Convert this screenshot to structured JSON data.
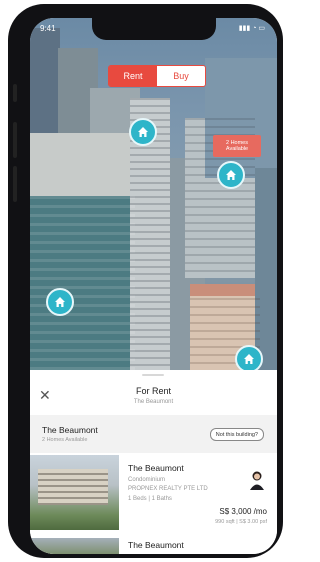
{
  "status_bar": {
    "time": "9:41",
    "icons": "▮▮▮ ◔ ▭"
  },
  "toggle": {
    "rent_label": "Rent",
    "buy_label": "Buy",
    "selected": "Rent"
  },
  "map": {
    "callout_line1": "2 Homes",
    "callout_line2": "Available",
    "pin_icon": "home-icon"
  },
  "sheet": {
    "title": "For Rent",
    "subtitle": "The Beaumont",
    "building": {
      "name": "The Beaumont",
      "availability": "2 Homes Available",
      "not_building_label": "Not this building?"
    }
  },
  "listings": [
    {
      "title": "The Beaumont",
      "type": "Condominium",
      "agency": "PROPNEX REALTY PTE LTD",
      "beds_baths": "1 Beds | 1 Baths",
      "price": "S$ 3,000 /mo",
      "size": "990 sqft | S$ 3.00 psf"
    },
    {
      "title": "The Beaumont"
    }
  ],
  "colors": {
    "accent": "#e84a3f",
    "pin": "#2eb5c9"
  }
}
